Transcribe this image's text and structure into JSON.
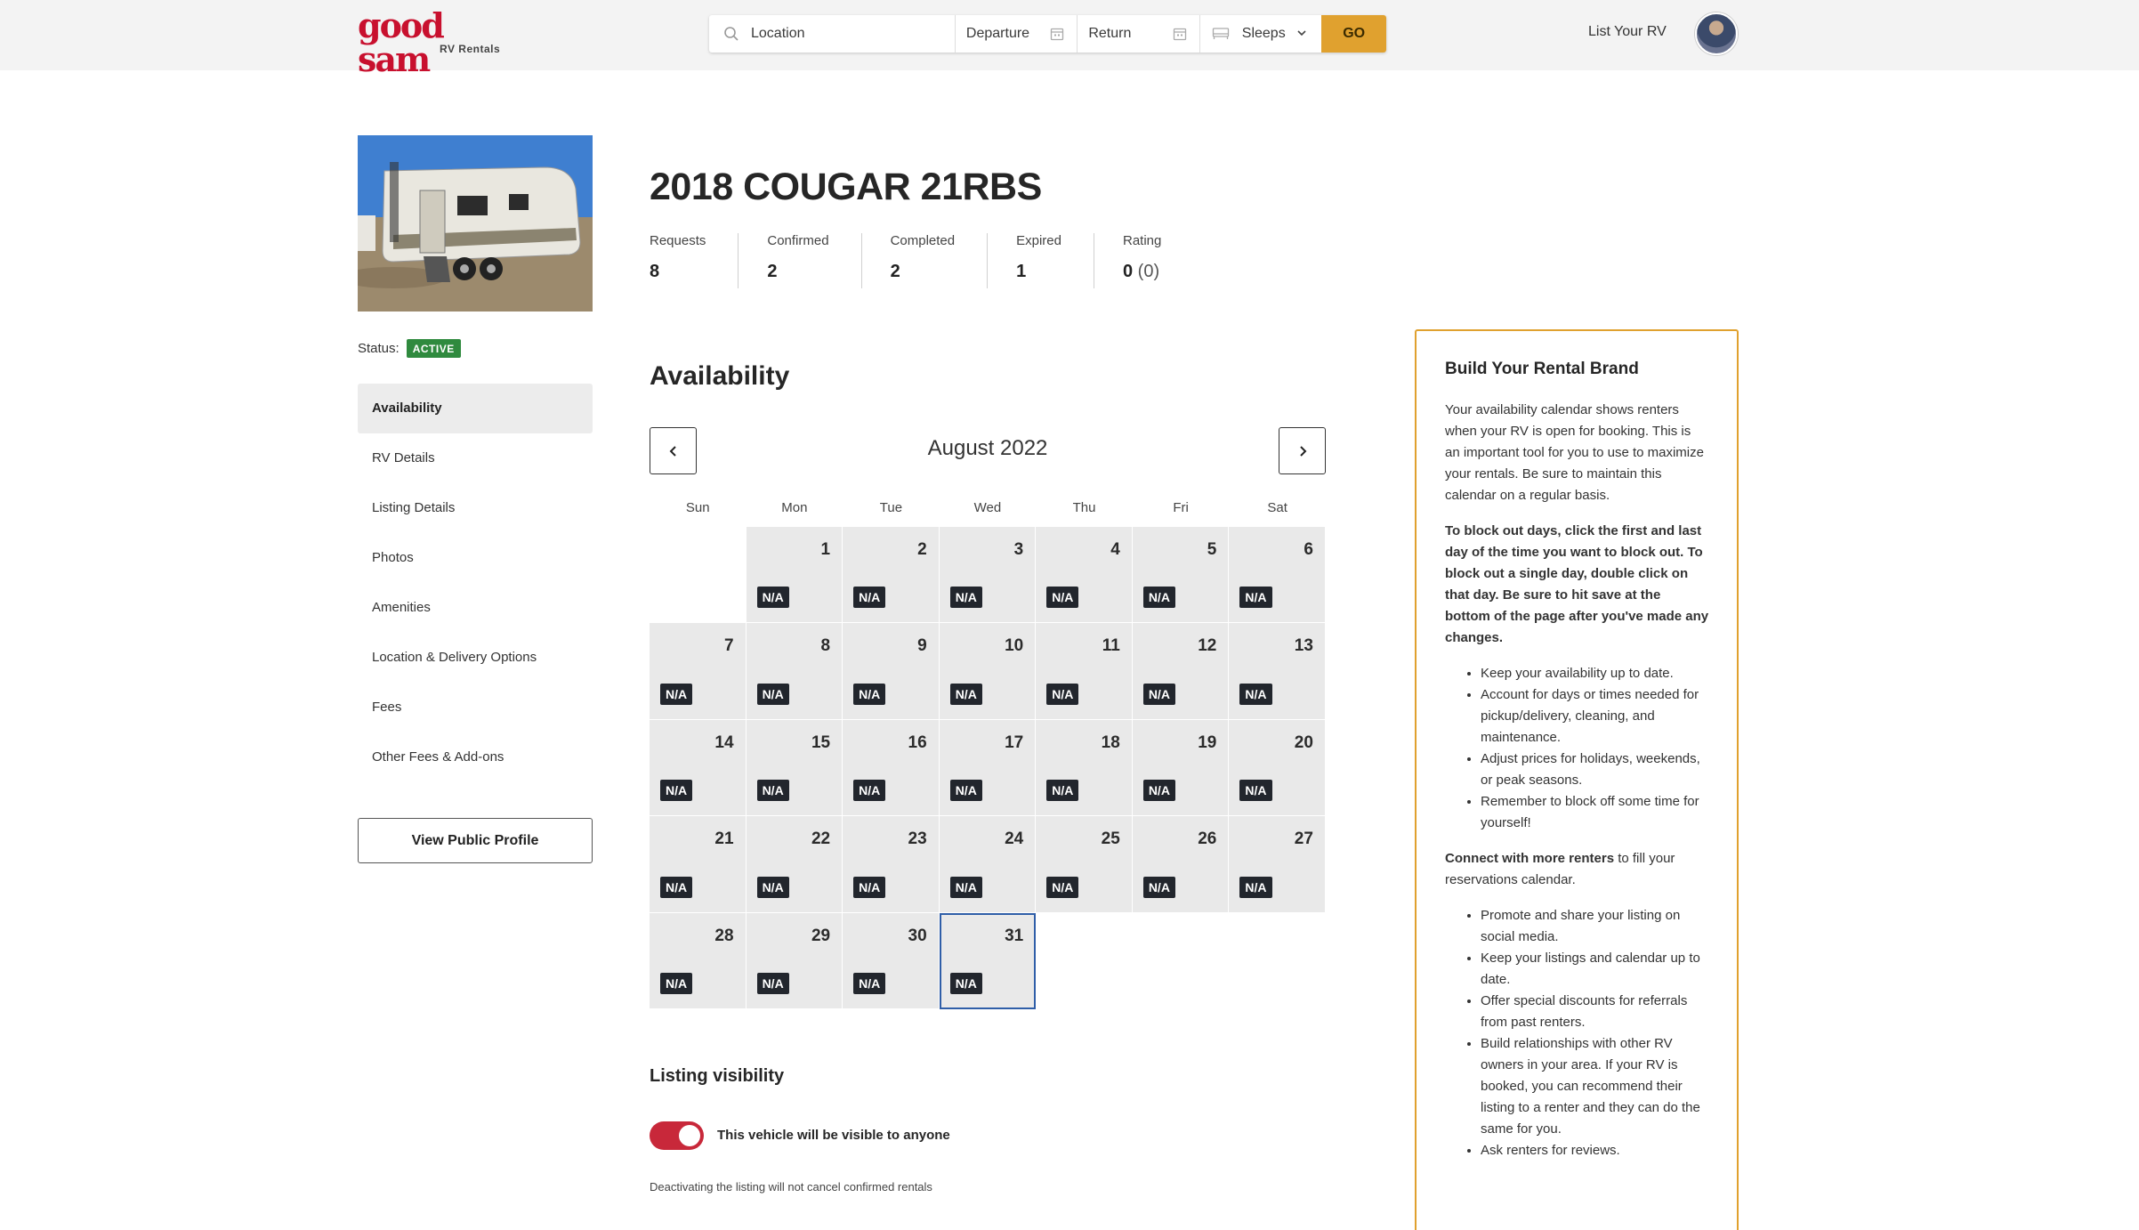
{
  "header": {
    "logo_main": "good sam",
    "logo_sub": "RV Rentals",
    "search": {
      "location_placeholder": "Location",
      "departure_label": "Departure",
      "return_label": "Return",
      "sleeps_label": "Sleeps",
      "go_label": "GO"
    },
    "list_your_rv": "List Your RV"
  },
  "sidebar": {
    "status_label": "Status:",
    "status_value": "ACTIVE",
    "items": [
      {
        "label": "Availability",
        "active": true
      },
      {
        "label": "RV Details"
      },
      {
        "label": "Listing Details"
      },
      {
        "label": "Photos"
      },
      {
        "label": "Amenities"
      },
      {
        "label": "Location & Delivery Options"
      },
      {
        "label": "Fees"
      },
      {
        "label": "Other Fees & Add-ons"
      }
    ],
    "view_profile_label": "View Public Profile"
  },
  "listing": {
    "title": "2018 COUGAR 21RBS",
    "stats": [
      {
        "label": "Requests",
        "value": "8"
      },
      {
        "label": "Confirmed",
        "value": "2"
      },
      {
        "label": "Completed",
        "value": "2"
      },
      {
        "label": "Expired",
        "value": "1"
      },
      {
        "label": "Rating",
        "value": "0",
        "extra": "(0)"
      }
    ]
  },
  "availability": {
    "heading": "Availability",
    "month_label": "August 2022",
    "weekdays": [
      "Sun",
      "Mon",
      "Tue",
      "Wed",
      "Thu",
      "Fri",
      "Sat"
    ],
    "leading_blanks": 1,
    "day_count": 31,
    "day_tag": "N/A",
    "selected_day": 31
  },
  "visibility": {
    "heading": "Listing visibility",
    "toggle_on": true,
    "toggle_label": "This vehicle will be visible to anyone",
    "note": "Deactivating the listing will not cancel confirmed rentals"
  },
  "brand_panel": {
    "title": "Build Your Rental Brand",
    "intro": "Your availability calendar shows renters when your RV is open for booking.  This is an important tool for you to use to maximize your rentals.  Be sure to maintain this calendar on a regular basis.",
    "instructions": "To block out days, click the first and last day of the time you want to block out.  To block out a single day, double click on that day.  Be sure to hit save at the bottom of the page after you've made any changes.",
    "tips": [
      "Keep your availability up to date.",
      "Account for days or times needed for pickup/delivery, cleaning, and maintenance.",
      "Adjust prices for holidays, weekends, or peak seasons.",
      "Remember to block off some time for yourself!"
    ],
    "connect_bold": "Connect with more renters",
    "connect_rest": " to fill your reservations calendar.",
    "connect_tips": [
      "Promote and share your listing on social media.",
      "Keep your listings and calendar up to date.",
      "Offer special discounts for referrals from past renters.",
      "Build relationships with other RV owners in your area.  If your RV is booked, you can recommend their listing to a renter and they can do the same for you.",
      "Ask renters for reviews."
    ]
  },
  "colors": {
    "brand_red": "#c8102e",
    "accent_gold": "#e0a12f",
    "status_green": "#2f8a3e",
    "toggle_red": "#c8283a",
    "selected_blue": "#2f5ea8"
  }
}
